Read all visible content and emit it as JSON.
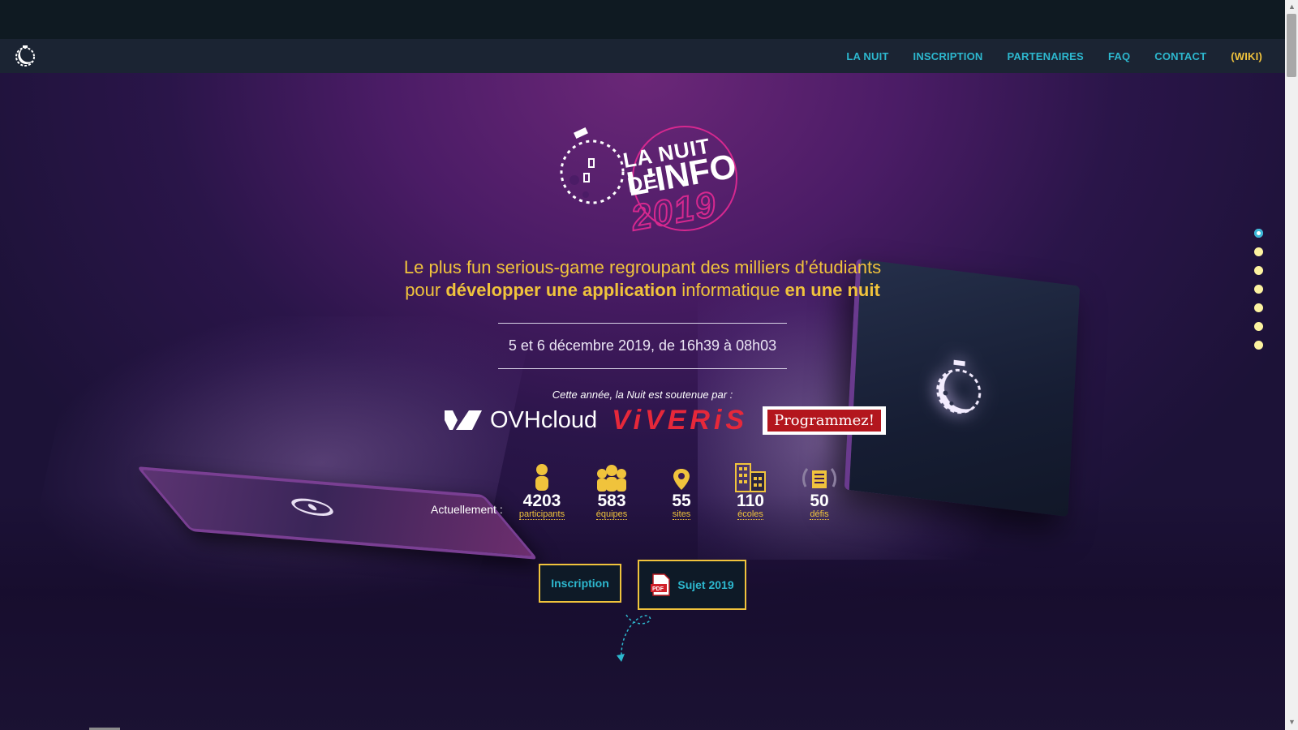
{
  "nav": {
    "items": [
      {
        "label": "LA NUIT"
      },
      {
        "label": "INSCRIPTION"
      },
      {
        "label": "PARTENAIRES"
      },
      {
        "label": "FAQ"
      },
      {
        "label": "CONTACT"
      },
      {
        "label": "(WIKI)"
      }
    ]
  },
  "brand": {
    "line1": "LA NUIT DE",
    "line2": "L'INFO",
    "year": "2019"
  },
  "tagline": {
    "line1": "Le plus fun serious-game regroupant des milliers d’étudiants",
    "line2_a": "pour ",
    "line2_b": "développer une application",
    "line2_c": " informatique ",
    "line2_d": "en une nuit"
  },
  "date": "5 et 6 décembre 2019, de 16h39 à 08h03",
  "sponsors": {
    "label": "Cette année, la Nuit est soutenue par :",
    "ovh": "OVHcloud",
    "viveris": "ViVERiS",
    "programmez": "Programmez!"
  },
  "stats": {
    "label": "Actuellement :",
    "items": [
      {
        "value": "4203",
        "label": "participants",
        "icon": "person-icon"
      },
      {
        "value": "583",
        "label": "équipes",
        "icon": "team-icon"
      },
      {
        "value": "55",
        "label": "sites",
        "icon": "map-pin-icon"
      },
      {
        "value": "110",
        "label": "écoles",
        "icon": "building-icon"
      },
      {
        "value": "50",
        "label": "défis",
        "icon": "laurel-icon"
      }
    ]
  },
  "buttons": {
    "inscription": "Inscription",
    "sujet": "Sujet 2019"
  },
  "colors": {
    "accent_yellow": "#f0c33c",
    "accent_cyan": "#2db8cf",
    "brand_pink": "#d6288f"
  },
  "section_dots": {
    "count": 7,
    "active_index": 0
  }
}
